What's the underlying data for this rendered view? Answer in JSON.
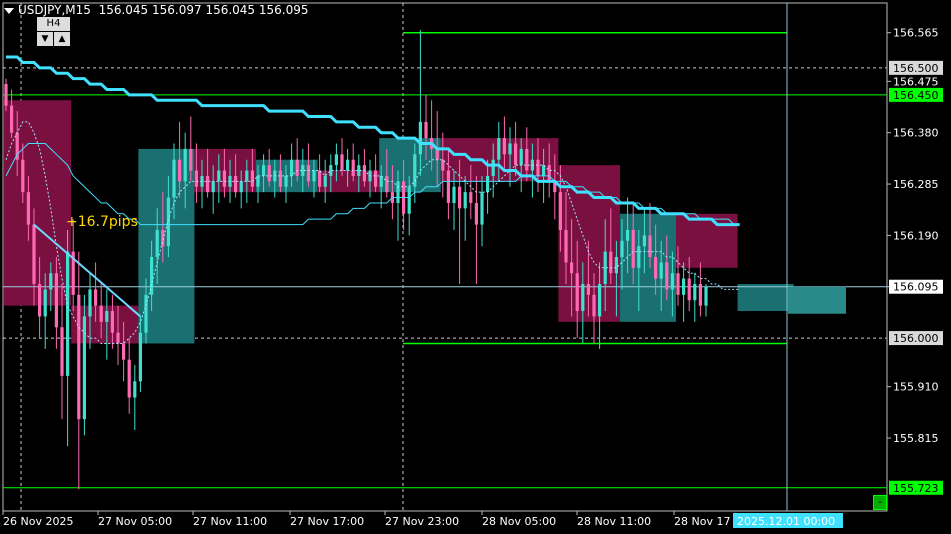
{
  "header": {
    "symbol_tf": "USDJPY,M15",
    "ohlc": "156.045 156.097 156.045 156.095"
  },
  "tf_box": {
    "label": "H4",
    "down": "▼",
    "up": "▲"
  },
  "annotation": "+16.7pips",
  "minus_button": "-",
  "colors": {
    "bg": "#000000",
    "bull": "#ff69b4",
    "bear": "#40e0d0",
    "box_bull": "#7a1040",
    "box_bear": "#1a7070",
    "ma": "#40e0ff",
    "line_green": "#00ff00"
  },
  "chart_data": {
    "type": "candlestick",
    "symbol": "USDJPY",
    "timeframe": "M15",
    "ylim": [
      155.68,
      156.62
    ],
    "y_ticks": [
      "156.565",
      "156.475",
      "156.380",
      "156.285",
      "156.190",
      "156.095",
      "155.910",
      "155.815"
    ],
    "price_tags": [
      {
        "label": "156.500",
        "value": 156.5,
        "style": "gray"
      },
      {
        "label": "156.450",
        "value": 156.45,
        "style": "green"
      },
      {
        "label": "156.095",
        "value": 156.095,
        "style": "white"
      },
      {
        "label": "156.000",
        "value": 156.0,
        "style": "gray"
      },
      {
        "label": "155.723",
        "value": 155.723,
        "style": "green"
      }
    ],
    "x_ticks": [
      "26 Nov 2025",
      "27 Nov 05:00",
      "27 Nov 11:00",
      "27 Nov 17:00",
      "27 Nov 23:00",
      "28 Nov 05:00",
      "28 Nov 11:00",
      "28 Nov 17"
    ],
    "x_highlight": "2025.12.01 00:00",
    "h4_boxes": [
      {
        "i0": 0,
        "i1": 12,
        "open": 156.44,
        "close": 156.06,
        "dir": "down"
      },
      {
        "i0": 12,
        "i1": 24,
        "open": 156.06,
        "close": 155.99,
        "dir": "down"
      },
      {
        "i0": 24,
        "i1": 34,
        "open": 155.99,
        "close": 156.35,
        "dir": "up"
      },
      {
        "i0": 34,
        "i1": 45,
        "open": 156.35,
        "close": 156.27,
        "dir": "down"
      },
      {
        "i0": 45,
        "i1": 56,
        "open": 156.27,
        "close": 156.33,
        "dir": "up"
      },
      {
        "i0": 56,
        "i1": 67,
        "open": 156.31,
        "close": 156.27,
        "dir": "down"
      },
      {
        "i0": 67,
        "i1": 78,
        "open": 156.27,
        "close": 156.37,
        "dir": "up"
      },
      {
        "i0": 78,
        "i1": 99,
        "open": 156.37,
        "close": 156.29,
        "dir": "down"
      },
      {
        "i0": 99,
        "i1": 110,
        "open": 156.32,
        "close": 156.03,
        "dir": "down"
      },
      {
        "i0": 110,
        "i1": 120,
        "open": 156.03,
        "close": 156.23,
        "dir": "up"
      },
      {
        "i0": 120,
        "i1": 131,
        "open": 156.23,
        "close": 156.13,
        "dir": "down"
      },
      {
        "i0": 131,
        "i1": 141,
        "open": 156.1,
        "close": 156.05,
        "dir": "up"
      }
    ],
    "candles": [
      [
        156.47,
        156.48,
        156.42,
        156.43
      ],
      [
        156.43,
        156.46,
        156.37,
        156.38
      ],
      [
        156.38,
        156.42,
        156.3,
        156.33
      ],
      [
        156.33,
        156.36,
        156.25,
        156.27
      ],
      [
        156.27,
        156.3,
        156.18,
        156.21
      ],
      [
        156.21,
        156.24,
        156.06,
        156.1
      ],
      [
        156.1,
        156.15,
        156.0,
        156.04
      ],
      [
        156.04,
        156.12,
        155.98,
        156.09
      ],
      [
        156.09,
        156.14,
        156.05,
        156.12
      ],
      [
        156.12,
        156.15,
        155.98,
        156.02
      ],
      [
        156.02,
        156.1,
        155.85,
        155.93
      ],
      [
        155.93,
        156.2,
        155.8,
        156.16
      ],
      [
        156.16,
        156.22,
        156.05,
        156.08
      ],
      [
        156.08,
        156.16,
        155.72,
        155.85
      ],
      [
        155.85,
        156.08,
        155.82,
        156.04
      ],
      [
        156.04,
        156.12,
        155.98,
        156.09
      ],
      [
        156.09,
        156.14,
        156.03,
        156.06
      ],
      [
        156.06,
        156.1,
        156.0,
        156.03
      ],
      [
        156.03,
        156.09,
        155.96,
        156.05
      ],
      [
        156.05,
        156.08,
        155.98,
        156.01
      ],
      [
        156.01,
        156.06,
        155.95,
        155.99
      ],
      [
        155.99,
        156.03,
        155.92,
        155.96
      ],
      [
        155.96,
        156.0,
        155.86,
        155.89
      ],
      [
        155.89,
        155.95,
        155.83,
        155.92
      ],
      [
        155.92,
        156.04,
        155.9,
        156.01
      ],
      [
        156.01,
        156.11,
        155.99,
        156.08
      ],
      [
        156.08,
        156.18,
        156.05,
        156.15
      ],
      [
        156.15,
        156.24,
        156.1,
        156.2
      ],
      [
        156.2,
        156.27,
        156.14,
        156.17
      ],
      [
        156.17,
        156.3,
        156.15,
        156.26
      ],
      [
        156.26,
        156.36,
        156.22,
        156.33
      ],
      [
        156.33,
        156.4,
        156.26,
        156.29
      ],
      [
        156.29,
        156.38,
        156.24,
        156.35
      ],
      [
        156.35,
        156.41,
        156.29,
        156.31
      ],
      [
        156.31,
        156.36,
        156.25,
        156.28
      ],
      [
        156.28,
        156.33,
        156.24,
        156.3
      ],
      [
        156.3,
        156.35,
        156.26,
        156.27
      ],
      [
        156.27,
        156.32,
        156.23,
        156.29
      ],
      [
        156.29,
        156.34,
        156.25,
        156.31
      ],
      [
        156.31,
        156.35,
        156.26,
        156.28
      ],
      [
        156.28,
        156.33,
        156.25,
        156.3
      ],
      [
        156.3,
        156.34,
        156.26,
        156.27
      ],
      [
        156.27,
        156.31,
        156.24,
        156.29
      ],
      [
        156.29,
        156.33,
        156.25,
        156.31
      ],
      [
        156.31,
        156.35,
        156.27,
        156.28
      ],
      [
        156.28,
        156.32,
        156.25,
        156.3
      ],
      [
        156.3,
        156.34,
        156.27,
        156.32
      ],
      [
        156.32,
        156.35,
        156.28,
        156.29
      ],
      [
        156.29,
        156.33,
        156.26,
        156.31
      ],
      [
        156.31,
        156.34,
        156.27,
        156.28
      ],
      [
        156.28,
        156.32,
        156.25,
        156.3
      ],
      [
        156.3,
        156.36,
        156.28,
        156.33
      ],
      [
        156.33,
        156.37,
        156.29,
        156.3
      ],
      [
        156.3,
        156.35,
        156.27,
        156.32
      ],
      [
        156.32,
        156.36,
        156.28,
        156.29
      ],
      [
        156.29,
        156.33,
        156.26,
        156.31
      ],
      [
        156.31,
        156.34,
        156.27,
        156.28
      ],
      [
        156.28,
        156.33,
        156.25,
        156.3
      ],
      [
        156.3,
        156.34,
        156.27,
        156.32
      ],
      [
        156.32,
        156.36,
        156.29,
        156.34
      ],
      [
        156.34,
        156.37,
        156.3,
        156.31
      ],
      [
        156.31,
        156.35,
        156.28,
        156.33
      ],
      [
        156.33,
        156.36,
        156.29,
        156.3
      ],
      [
        156.3,
        156.34,
        156.27,
        156.32
      ],
      [
        156.32,
        156.35,
        156.28,
        156.29
      ],
      [
        156.29,
        156.33,
        156.26,
        156.31
      ],
      [
        156.31,
        156.34,
        156.27,
        156.28
      ],
      [
        156.28,
        156.32,
        156.24,
        156.3
      ],
      [
        156.3,
        156.35,
        156.26,
        156.27
      ],
      [
        156.27,
        156.32,
        156.22,
        156.25
      ],
      [
        156.25,
        156.31,
        156.18,
        156.29
      ],
      [
        156.29,
        156.33,
        156.2,
        156.23
      ],
      [
        156.23,
        156.3,
        156.19,
        156.28
      ],
      [
        156.28,
        156.36,
        156.25,
        156.34
      ],
      [
        156.34,
        156.57,
        156.3,
        156.4
      ],
      [
        156.4,
        156.45,
        156.33,
        156.37
      ],
      [
        156.37,
        156.44,
        156.31,
        156.35
      ],
      [
        156.35,
        156.42,
        156.28,
        156.33
      ],
      [
        156.33,
        156.38,
        156.26,
        156.31
      ],
      [
        156.31,
        156.35,
        156.22,
        156.25
      ],
      [
        156.25,
        156.31,
        156.2,
        156.28
      ],
      [
        156.28,
        156.33,
        156.1,
        156.24
      ],
      [
        156.24,
        156.3,
        156.18,
        156.27
      ],
      [
        156.27,
        156.32,
        156.22,
        156.25
      ],
      [
        156.25,
        156.3,
        156.1,
        156.21
      ],
      [
        156.21,
        156.3,
        156.17,
        156.27
      ],
      [
        156.27,
        156.33,
        156.23,
        156.3
      ],
      [
        156.3,
        156.36,
        156.26,
        156.33
      ],
      [
        156.33,
        156.4,
        156.29,
        156.37
      ],
      [
        156.37,
        156.41,
        156.31,
        156.34
      ],
      [
        156.34,
        156.39,
        156.28,
        156.36
      ],
      [
        156.36,
        156.4,
        156.3,
        156.32
      ],
      [
        156.32,
        156.37,
        156.27,
        156.35
      ],
      [
        156.35,
        156.39,
        156.29,
        156.31
      ],
      [
        156.31,
        156.36,
        156.26,
        156.33
      ],
      [
        156.33,
        156.37,
        156.27,
        156.3
      ],
      [
        156.3,
        156.35,
        156.25,
        156.32
      ],
      [
        156.32,
        156.36,
        156.26,
        156.29
      ],
      [
        156.29,
        156.34,
        156.22,
        156.27
      ],
      [
        156.27,
        156.32,
        156.16,
        156.2
      ],
      [
        156.2,
        156.27,
        156.1,
        156.14
      ],
      [
        156.14,
        156.22,
        156.04,
        156.12
      ],
      [
        156.12,
        156.18,
        156.0,
        156.05
      ],
      [
        156.05,
        156.14,
        155.99,
        156.1
      ],
      [
        156.1,
        156.18,
        156.04,
        156.08
      ],
      [
        156.08,
        156.12,
        155.99,
        156.04
      ],
      [
        156.04,
        156.14,
        155.98,
        156.1
      ],
      [
        156.1,
        156.22,
        156.05,
        156.16
      ],
      [
        156.16,
        156.24,
        156.1,
        156.12
      ],
      [
        156.12,
        156.18,
        156.04,
        156.15
      ],
      [
        156.15,
        156.22,
        156.09,
        156.18
      ],
      [
        156.18,
        156.26,
        156.12,
        156.2
      ],
      [
        156.2,
        156.25,
        156.1,
        156.13
      ],
      [
        156.13,
        156.2,
        156.05,
        156.17
      ],
      [
        156.17,
        156.24,
        156.12,
        156.19
      ],
      [
        156.19,
        156.25,
        156.13,
        156.15
      ],
      [
        156.15,
        156.21,
        156.08,
        156.11
      ],
      [
        156.11,
        156.18,
        156.05,
        156.14
      ],
      [
        156.14,
        156.19,
        156.07,
        156.09
      ],
      [
        156.09,
        156.16,
        156.04,
        156.12
      ],
      [
        156.12,
        156.17,
        156.06,
        156.08
      ],
      [
        156.08,
        156.14,
        156.03,
        156.11
      ],
      [
        156.11,
        156.15,
        156.05,
        156.07
      ],
      [
        156.07,
        156.12,
        156.03,
        156.1
      ],
      [
        156.1,
        156.14,
        156.04,
        156.06
      ],
      [
        156.06,
        156.1,
        156.04,
        156.095
      ]
    ],
    "ma_fast": [
      156.33,
      156.36,
      156.38,
      156.4,
      156.4,
      156.38,
      156.35,
      156.3,
      156.24,
      156.17,
      156.11,
      156.06,
      156.04,
      156.02,
      156.01,
      156.0,
      156.0,
      155.99,
      155.99,
      155.99,
      155.99,
      155.99,
      156.0,
      156.01,
      156.03,
      156.06,
      156.1,
      156.14,
      156.18,
      156.22,
      156.25,
      156.27,
      156.28,
      156.29,
      156.29,
      156.29,
      156.29,
      156.29,
      156.29,
      156.29,
      156.29,
      156.29,
      156.29,
      156.29,
      156.29,
      156.3,
      156.3,
      156.3,
      156.3,
      156.3,
      156.3,
      156.3,
      156.31,
      156.31,
      156.31,
      156.31,
      156.31,
      156.3,
      156.31,
      156.31,
      156.31,
      156.31,
      156.31,
      156.31,
      156.31,
      156.3,
      156.3,
      156.3,
      156.29,
      156.29,
      156.28,
      156.28,
      156.28,
      156.29,
      156.31,
      156.32,
      156.33,
      156.33,
      156.33,
      156.32,
      156.31,
      156.3,
      156.29,
      156.28,
      156.27,
      156.27,
      156.27,
      156.28,
      156.29,
      156.3,
      156.31,
      156.32,
      156.32,
      156.32,
      156.32,
      156.32,
      156.32,
      156.31,
      156.31,
      156.3,
      156.28,
      156.25,
      156.22,
      156.19,
      156.16,
      156.14,
      156.13,
      156.13,
      156.13,
      156.13,
      156.14,
      156.15,
      156.16,
      156.16,
      156.16,
      156.16,
      156.16,
      156.16,
      156.15,
      156.15,
      156.14,
      156.13,
      156.12,
      156.12,
      156.11,
      156.11,
      156.1,
      156.1,
      156.09,
      156.09,
      156.09,
      156.09
    ],
    "ma_mid": [
      156.3,
      156.32,
      156.34,
      156.35,
      156.36,
      156.36,
      156.36,
      156.36,
      156.35,
      156.34,
      156.33,
      156.32,
      156.3,
      156.29,
      156.28,
      156.27,
      156.26,
      156.25,
      156.25,
      156.24,
      156.23,
      156.23,
      156.22,
      156.22,
      156.21,
      156.21,
      156.21,
      156.21,
      156.21,
      156.21,
      156.21,
      156.21,
      156.21,
      156.21,
      156.21,
      156.21,
      156.21,
      156.21,
      156.21,
      156.21,
      156.21,
      156.21,
      156.21,
      156.21,
      156.21,
      156.21,
      156.21,
      156.21,
      156.21,
      156.21,
      156.21,
      156.21,
      156.21,
      156.21,
      156.22,
      156.22,
      156.22,
      156.22,
      156.22,
      156.23,
      156.23,
      156.23,
      156.24,
      156.24,
      156.24,
      156.25,
      156.25,
      156.25,
      156.25,
      156.26,
      156.26,
      156.26,
      156.26,
      156.27,
      156.27,
      156.28,
      156.28,
      156.28,
      156.29,
      156.29,
      156.29,
      156.29,
      156.29,
      156.29,
      156.29,
      156.29,
      156.29,
      156.29,
      156.29,
      156.29,
      156.29,
      156.29,
      156.3,
      156.3,
      156.3,
      156.3,
      156.3,
      156.3,
      156.29,
      156.29,
      156.29,
      156.28,
      156.28,
      156.28,
      156.27,
      156.27,
      156.27,
      156.26,
      156.26,
      156.26,
      156.25,
      156.25,
      156.25,
      156.25,
      156.24,
      156.24,
      156.24,
      156.24,
      156.23,
      156.23,
      156.23,
      156.23,
      156.23,
      156.23,
      156.22,
      156.22,
      156.22,
      156.22,
      156.22,
      156.22,
      156.21,
      156.21
    ],
    "ma_slow": [
      156.52,
      156.52,
      156.52,
      156.51,
      156.51,
      156.51,
      156.5,
      156.5,
      156.5,
      156.49,
      156.49,
      156.49,
      156.48,
      156.48,
      156.48,
      156.47,
      156.47,
      156.47,
      156.46,
      156.46,
      156.46,
      156.46,
      156.45,
      156.45,
      156.45,
      156.45,
      156.45,
      156.44,
      156.44,
      156.44,
      156.44,
      156.44,
      156.44,
      156.44,
      156.44,
      156.43,
      156.43,
      156.43,
      156.43,
      156.43,
      156.43,
      156.43,
      156.43,
      156.43,
      156.43,
      156.43,
      156.43,
      156.42,
      156.42,
      156.42,
      156.42,
      156.42,
      156.42,
      156.42,
      156.41,
      156.41,
      156.41,
      156.41,
      156.41,
      156.4,
      156.4,
      156.4,
      156.4,
      156.39,
      156.39,
      156.39,
      156.39,
      156.38,
      156.38,
      156.38,
      156.37,
      156.37,
      156.37,
      156.37,
      156.36,
      156.36,
      156.36,
      156.35,
      156.35,
      156.35,
      156.34,
      156.34,
      156.34,
      156.33,
      156.33,
      156.33,
      156.32,
      156.32,
      156.32,
      156.31,
      156.31,
      156.31,
      156.3,
      156.3,
      156.3,
      156.29,
      156.29,
      156.29,
      156.29,
      156.28,
      156.28,
      156.28,
      156.27,
      156.27,
      156.27,
      156.26,
      156.26,
      156.26,
      156.26,
      156.25,
      156.25,
      156.25,
      156.25,
      156.24,
      156.24,
      156.24,
      156.24,
      156.23,
      156.23,
      156.23,
      156.23,
      156.23,
      156.22,
      156.22,
      156.22,
      156.22,
      156.22,
      156.21,
      156.21,
      156.21,
      156.21,
      156.21
    ],
    "trendline": {
      "i0": 5,
      "v0": 156.21,
      "i1": 24,
      "v1": 156.04
    }
  }
}
